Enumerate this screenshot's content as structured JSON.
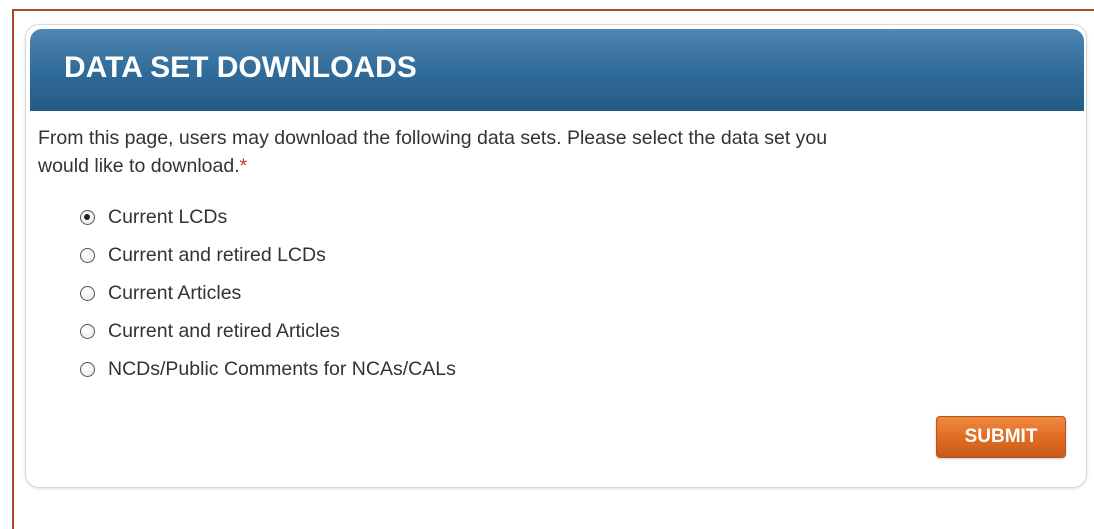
{
  "panel": {
    "title": "DATA SET DOWNLOADS",
    "intro_line1": "From this page, users may download the following data sets. Please select the data set you",
    "intro_line2": "would like to download.",
    "required_marker": "*"
  },
  "options": [
    {
      "label": "Current LCDs",
      "checked": true
    },
    {
      "label": "Current and retired LCDs",
      "checked": false
    },
    {
      "label": "Current Articles",
      "checked": false
    },
    {
      "label": "Current and retired Articles",
      "checked": false
    },
    {
      "label": "NCDs/Public Comments for NCAs/CALs",
      "checked": false
    }
  ],
  "submit_label": "SUBMIT",
  "colors": {
    "header": "#2f6a98",
    "submit": "#dd6b22",
    "frame": "#a84a2c",
    "required": "#c0392b"
  }
}
